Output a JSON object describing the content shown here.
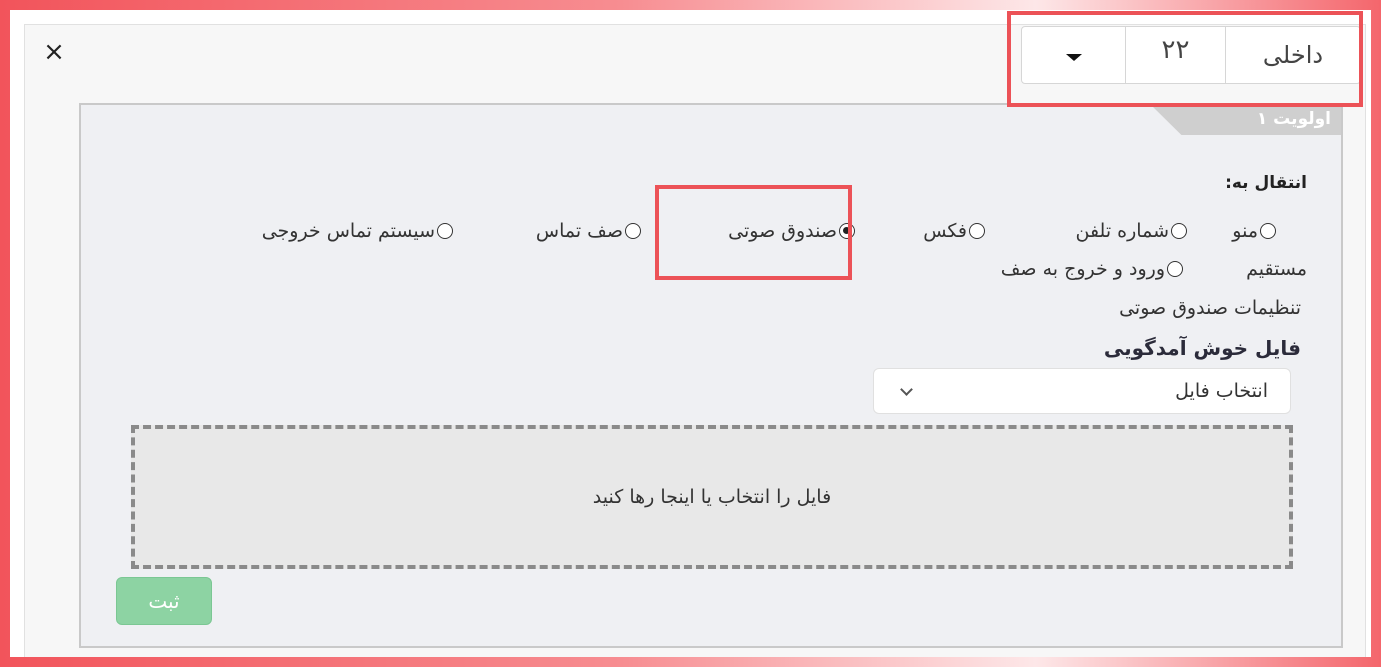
{
  "close_icon": "close-icon",
  "extension": {
    "type_value": "داخلی",
    "number_value": "۲۲",
    "dropdown_icon": "caret-down-icon"
  },
  "priority": {
    "label": "اولویت ۱"
  },
  "transfer": {
    "label": "انتقال به:",
    "options": [
      {
        "label": "منو",
        "checked": false
      },
      {
        "label": "شماره تلفن",
        "checked": false
      },
      {
        "label": "فکس",
        "checked": false
      },
      {
        "label": "صندوق صوتی",
        "checked": true
      },
      {
        "label": "صف تماس",
        "checked": false
      },
      {
        "label": "سیستم تماس خروجی",
        "checked": false
      }
    ],
    "options_row2": [
      {
        "label": "مستقیم",
        "checked": false
      },
      {
        "label": "ورود و خروج به صف",
        "checked": false
      }
    ]
  },
  "voicemail": {
    "settings_label": "تنظیمات صندوق صوتی",
    "welcome_label": "فایل خوش آمدگویی",
    "file_select_value": "انتخاب فایل",
    "dropzone_text": "فایل را انتخاب یا اینجا رها کنید"
  },
  "submit_label": "ثبت",
  "colors": {
    "highlight": "#ec5257",
    "submit": "#8dd3a3",
    "panel": "#eff0f3"
  }
}
